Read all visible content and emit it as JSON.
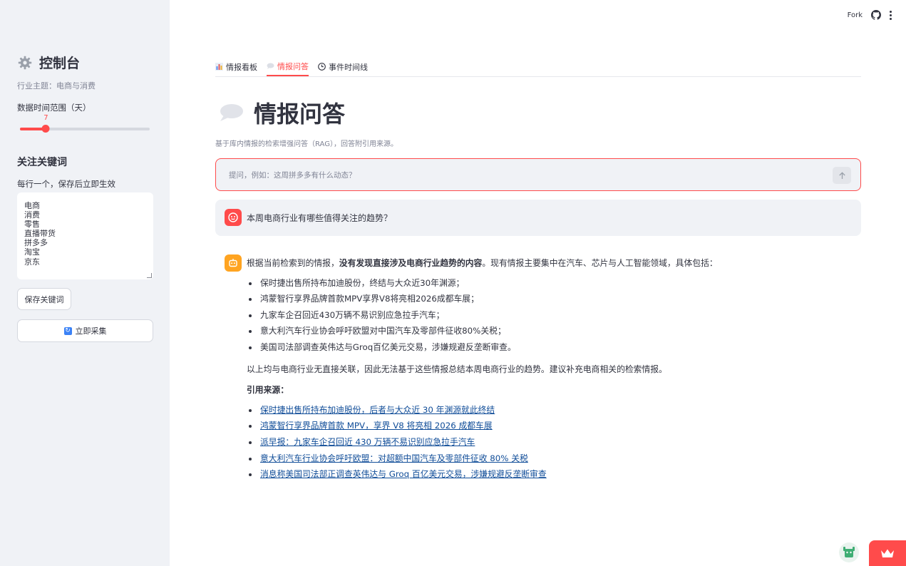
{
  "sidebar": {
    "title": "控制台",
    "title_icon": "gear-icon",
    "topic": "行业主题：电商与消费",
    "range_label": "数据时间范围（天）",
    "range_value": "7",
    "range_fraction": 0.2,
    "keywords_heading": "关注关键词",
    "keywords_hint": "每行一个，保存后立即生效",
    "keywords": [
      "电商",
      "消费",
      "零售",
      "直播带货",
      "拼多多",
      "淘宝",
      "京东"
    ],
    "save_button": "保存关键词",
    "collect_button": "立即采集",
    "collect_icon": "refresh-icon"
  },
  "topbar": {
    "fork_label": "Fork",
    "github_icon": "github-icon",
    "menu_icon": "kebab-menu-icon"
  },
  "tabs": [
    {
      "label": "情报看板",
      "icon": "bar-chart-icon",
      "active": false
    },
    {
      "label": "情报问答",
      "icon": "speech-bubble-icon",
      "active": true
    },
    {
      "label": "事件时间线",
      "icon": "clock-icon",
      "active": false
    }
  ],
  "main": {
    "title": "情报问答",
    "title_icon": "speech-bubble-icon",
    "caption": "基于库内情报的检索增强问答（RAG），回答附引用来源。",
    "input_placeholder": "提问，例如：这周拼多多有什么动态？"
  },
  "chat": {
    "user_message": "本周电商行业有哪些值得关注的趋势？",
    "bot": {
      "intro_pre": "根据当前检索到的情报，",
      "intro_bold": "没有发现直接涉及电商行业趋势的内容",
      "intro_post": "。现有情报主要集中在汽车、芯片与人工智能领域，具体包括：",
      "items": [
        "保时捷出售所持布加迪股份，终结与大众近30年渊源；",
        "鸿蒙智行享界品牌首款MPV享界V8将亮相2026成都车展；",
        "九家车企召回近430万辆不易识别应急拉手汽车；",
        "意大利汽车行业协会呼吁欧盟对中国汽车及零部件征收80%关税；",
        "美国司法部调查英伟达与Groq百亿美元交易，涉嫌规避反垄断审查。"
      ],
      "conclusion": "以上均与电商行业无直接关联，因此无法基于这些情报总结本周电商行业的趋势。建议补充电商相关的检索情报。",
      "sources_heading": "引用来源：",
      "sources": [
        "保时捷出售所持布加迪股份，后者与大众近 30 年渊源就此终结",
        "鸿蒙智行享界品牌首款 MPV，享界 V8 将亮相 2026 成都车展",
        "派早报：九家车企召回近 430 万辆不易识别应急拉手汽车",
        "意大利汽车行业协会呼吁欧盟：对超额中国汽车及零部件征收 80% 关税",
        "消息称美国司法部正调查英伟达与 Groq 百亿美元交易，涉嫌规避反垄断审查"
      ]
    }
  },
  "colors": {
    "accent": "#ff4b4b",
    "sidebar_bg": "#f0f2f6",
    "link": "#0f4c98",
    "bot_avatar": "#ffa421"
  }
}
